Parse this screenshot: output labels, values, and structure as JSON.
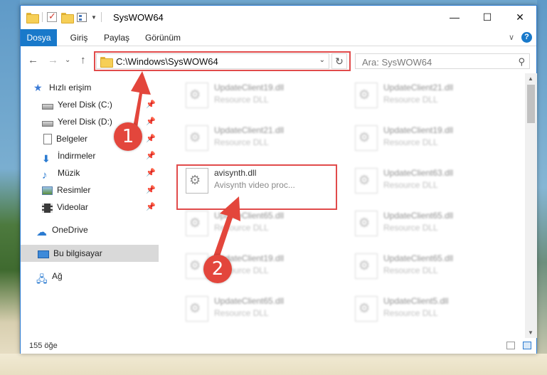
{
  "window": {
    "title": "SysWOW64",
    "controls": {
      "minimize": "—",
      "maximize": "☐",
      "close": "✕"
    }
  },
  "ribbon": {
    "tabs": [
      "Dosya",
      "Giriş",
      "Paylaş",
      "Görünüm"
    ],
    "active_tab": "Dosya",
    "expand_chevron": "∨",
    "help": "?"
  },
  "address": {
    "path": "C:\\Windows\\SysWOW64",
    "dropdown": "⌄",
    "refresh": "↻",
    "search_placeholder": "Ara: SysWOW64",
    "search_icon": "⚲"
  },
  "nav": {
    "back": "←",
    "forward": "→",
    "recent": "⌄",
    "up": "↑",
    "items": [
      {
        "label": "Hızlı erişim",
        "icon": "star-icon",
        "pinned": false
      },
      {
        "label": "Yerel Disk (C:)",
        "icon": "drive-icon",
        "pinned": true
      },
      {
        "label": "Yerel Disk (D:)",
        "icon": "drive-icon",
        "pinned": true
      },
      {
        "label": "Belgeler",
        "icon": "documents-icon",
        "pinned": true
      },
      {
        "label": "İndirmeler",
        "icon": "downloads-icon",
        "pinned": true
      },
      {
        "label": "Müzik",
        "icon": "music-icon",
        "pinned": true
      },
      {
        "label": "Resimler",
        "icon": "pictures-icon",
        "pinned": true
      },
      {
        "label": "Videolar",
        "icon": "videos-icon",
        "pinned": true
      },
      {
        "label": "OneDrive",
        "icon": "cloud-icon",
        "pinned": false
      },
      {
        "label": "Bu bilgisayar",
        "icon": "computer-icon",
        "pinned": false,
        "selected": true
      },
      {
        "label": "Ağ",
        "icon": "network-icon",
        "pinned": false
      }
    ],
    "pin_glyph": "📌"
  },
  "files": {
    "left": [
      {
        "name": "UpdateClient19.dll",
        "desc": "Resource DLL"
      },
      {
        "name": "UpdateClient21.dll",
        "desc": "Resource DLL"
      },
      {
        "name": "avisynth.dll",
        "desc": "Avisynth video proc...",
        "highlighted": true
      },
      {
        "name": "UpdateClient65.dll",
        "desc": "Resource DLL"
      },
      {
        "name": "UpdateClient19.dll",
        "desc": "Resource DLL"
      },
      {
        "name": "UpdateClient65.dll",
        "desc": "Resource DLL"
      }
    ],
    "right": [
      {
        "name": "UpdateClient21.dll",
        "desc": "Resource DLL"
      },
      {
        "name": "UpdateClient19.dll",
        "desc": "Resource DLL"
      },
      {
        "name": "UpdateClient63.dll",
        "desc": "Resource DLL"
      },
      {
        "name": "UpdateClient65.dll",
        "desc": "Resource DLL"
      },
      {
        "name": "UpdateClient65.dll",
        "desc": "Resource DLL"
      },
      {
        "name": "UpdateClient5.dll",
        "desc": "Resource DLL"
      }
    ]
  },
  "status": {
    "item_count": "155 öğe"
  },
  "annotations": {
    "step1": "1",
    "step2": "2",
    "color": "#e3463c"
  }
}
